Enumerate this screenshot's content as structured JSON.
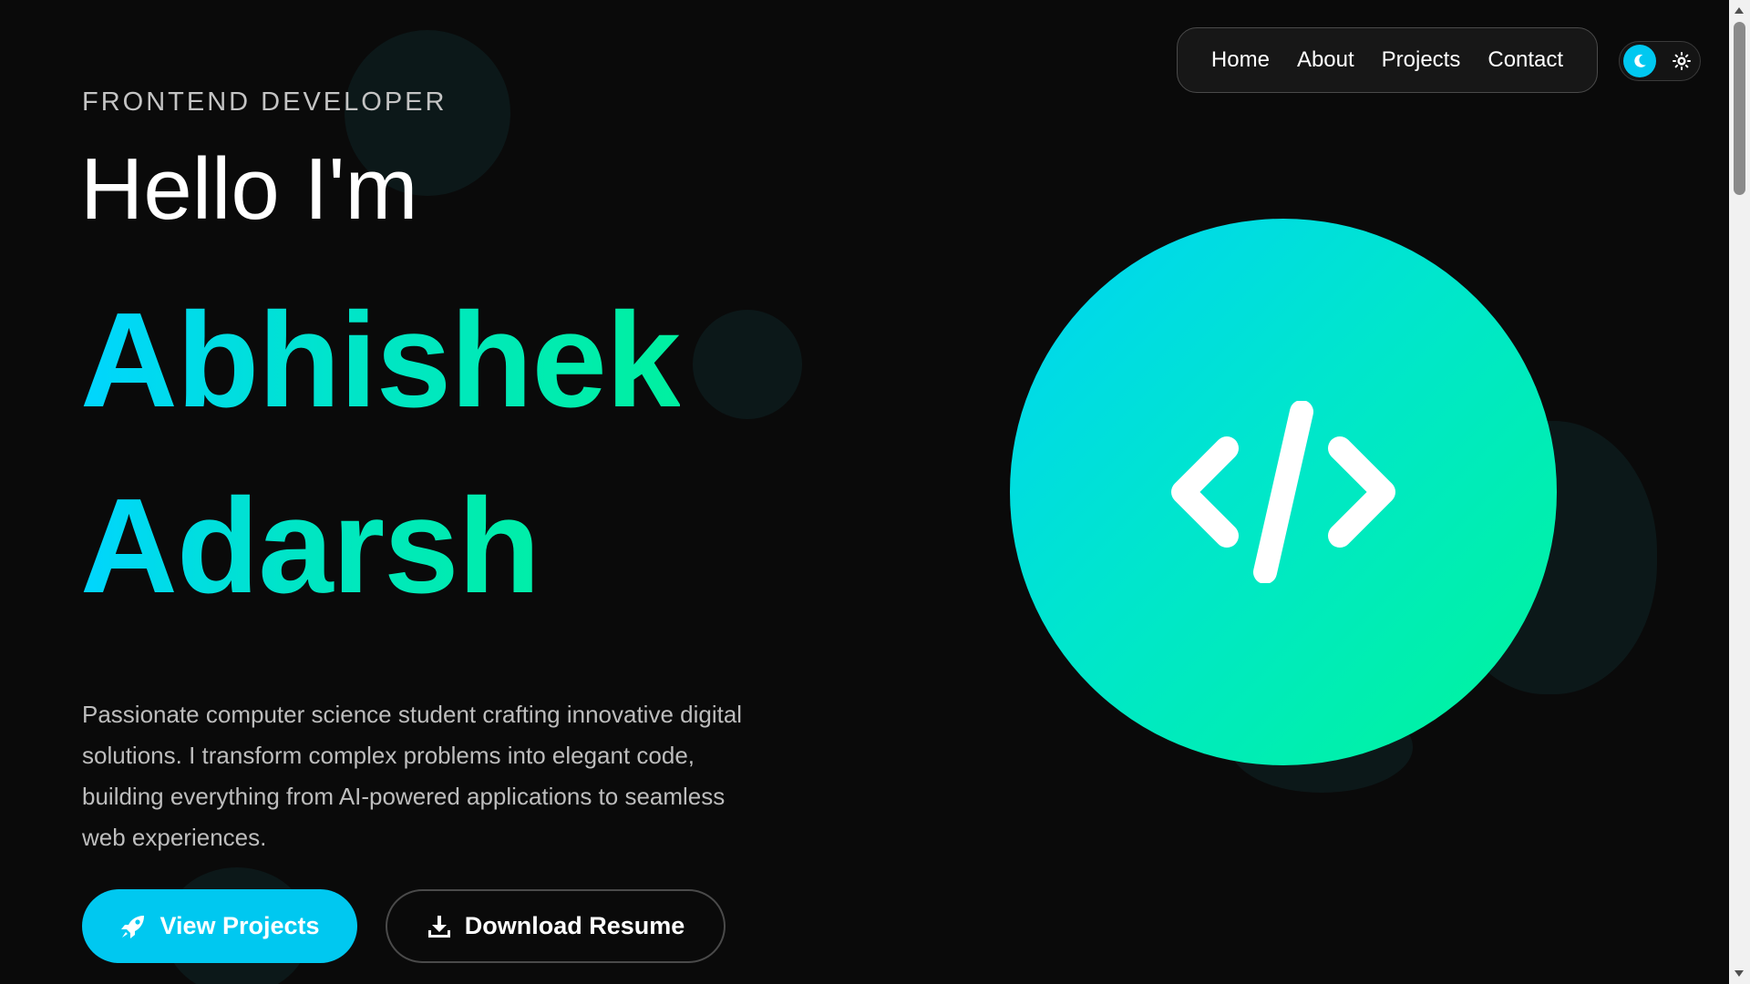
{
  "nav": {
    "links": [
      {
        "label": "Home"
      },
      {
        "label": "About"
      },
      {
        "label": "Projects"
      },
      {
        "label": "Contact"
      }
    ]
  },
  "theme_toggle": {
    "active_mode": "dark",
    "icons": [
      "moon-icon",
      "sun-icon"
    ]
  },
  "hero": {
    "subtitle": "FRONTEND DEVELOPER",
    "greeting": "Hello I'm",
    "first_name": "Abhishek",
    "last_name": "Adarsh",
    "description": "Passionate computer science student crafting innovative digital solutions. I transform complex problems into elegant code, building everything from AI-powered applications to seamless web experiences.",
    "graphic_icon": "code-icon"
  },
  "buttons": {
    "primary": {
      "label": "View Projects",
      "icon": "rocket-icon"
    },
    "secondary": {
      "label": "Download Resume",
      "icon": "download-icon"
    }
  },
  "colors": {
    "background": "#0a0a0a",
    "accent_cyan": "#00c8f0",
    "accent_green": "#00f59a",
    "text_primary": "#ffffff",
    "text_muted": "#bdbdbd"
  }
}
